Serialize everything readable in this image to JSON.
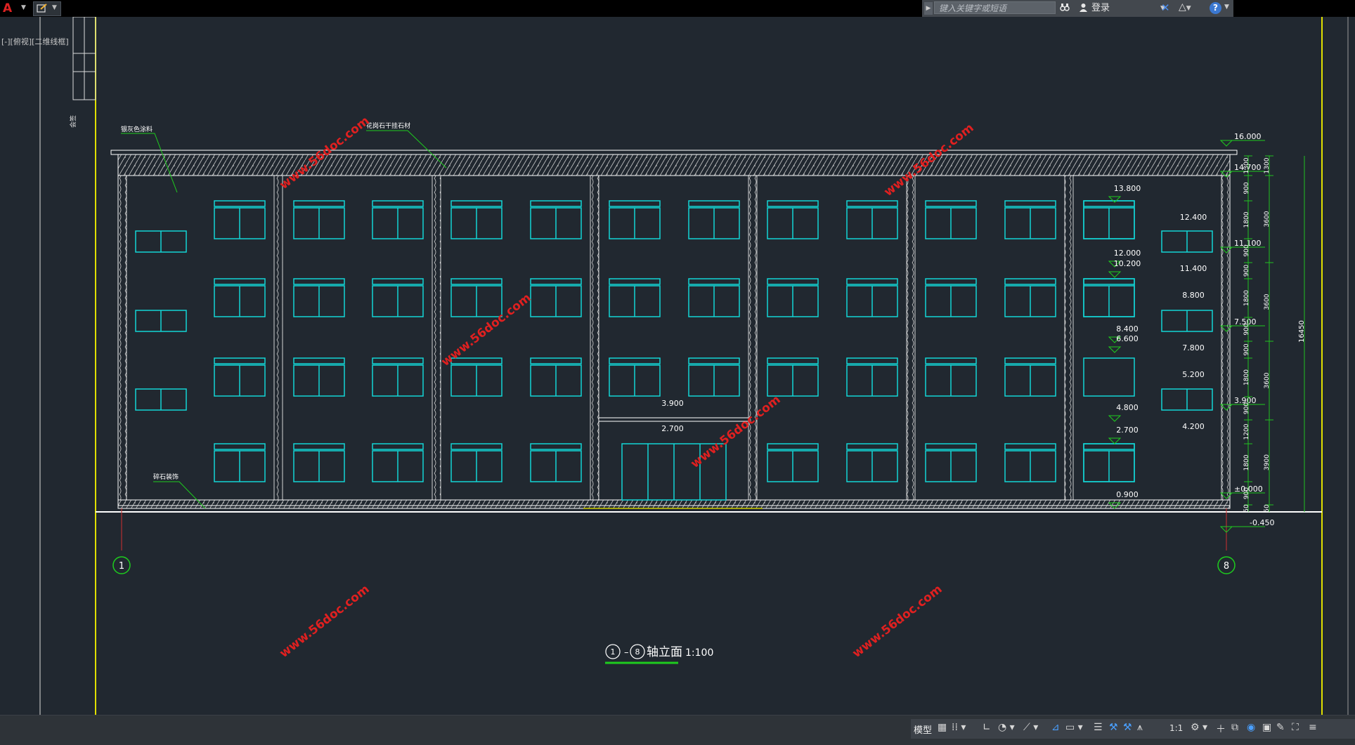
{
  "app": {
    "logo_glyph": "A",
    "accent_color": "#e33131"
  },
  "quick_access": {
    "icon": "open-file-icon"
  },
  "infocenter": {
    "search_placeholder": "键入关键字或短语",
    "user_label": "登录",
    "help_glyph": "?"
  },
  "window_controls": {
    "minimize": "–",
    "restore": "❐",
    "close": "×"
  },
  "viewport_label": "[-][俯视][二维线框]",
  "drawing": {
    "title": "⑴-⑻轴立面",
    "title_circle_1": "1",
    "title_circle_2": "8",
    "title_text": "轴立面",
    "scale": "1:100",
    "axis_left": "1",
    "axis_right": "8",
    "notes": {
      "coating": "银灰色涂料",
      "stone": "花岗石干挂石材",
      "base": "碎石装饰"
    },
    "side_note": "会签",
    "watermark": "www.56doc.com",
    "elevations_right": [
      "16.000",
      "14.700",
      "11.100",
      "7.500",
      "3.900",
      "±0.000",
      "-0.450"
    ],
    "elevations_stair": [
      "13.800",
      "12.000",
      "10.200",
      "8.400",
      "6.600",
      "4.800",
      "2.700",
      "0.900"
    ],
    "elevations_small": [
      "12.400",
      "11.400",
      "8.800",
      "7.800",
      "5.200",
      "4.200"
    ],
    "elevations_entrance": [
      "3.900",
      "2.700"
    ],
    "dim_inner": [
      "1300",
      "900",
      "1800",
      "900",
      "900",
      "1800",
      "900",
      "900",
      "1800",
      "900",
      "1200",
      "1800",
      "900",
      "50"
    ],
    "dim_middle": [
      "1300",
      "3600",
      "3600",
      "3600",
      "3900",
      "50"
    ],
    "dim_total": "16450",
    "colors": {
      "line": "#ffffff",
      "window": "#13d6d6",
      "green": "#1ecc1e",
      "dim_line": "#21c021",
      "axis_yellow": "#e0e000",
      "red": "#d03030"
    }
  },
  "statusbar": {
    "model_label": "模型",
    "scale_label": "1:1",
    "icons": [
      "grid-icon",
      "snap-icon",
      "ortho-icon",
      "polar-icon",
      "isodraft-icon",
      "object-snap-icon",
      "track-icon",
      "lineweight-icon",
      "transparency-icon",
      "annotation-icon",
      "workspace-icon",
      "settings-icon",
      "plus-icon",
      "isolate-icon",
      "hardware-icon",
      "fullscreen-icon",
      "menu-icon"
    ]
  }
}
